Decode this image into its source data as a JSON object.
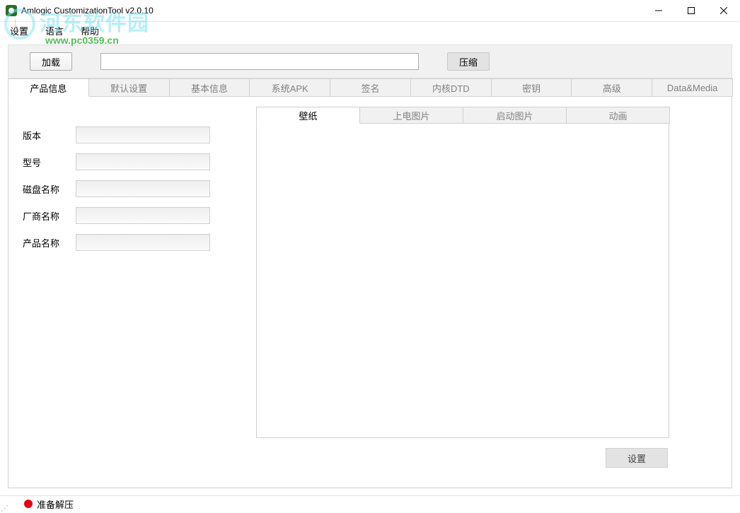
{
  "window": {
    "title": "Amlogic CustomizationTool v2.0.10"
  },
  "menu": {
    "settings": "设置",
    "language": "语言",
    "help": "帮助"
  },
  "watermark": {
    "text": "河东软件园",
    "url": "www.pc0359.cn"
  },
  "toolbar": {
    "load": "加载",
    "path_value": "",
    "compress": "压缩"
  },
  "mainTabs": [
    {
      "label": "产品信息",
      "active": true
    },
    {
      "label": "默认设置",
      "active": false
    },
    {
      "label": "基本信息",
      "active": false
    },
    {
      "label": "系统APK",
      "active": false
    },
    {
      "label": "签名",
      "active": false
    },
    {
      "label": "内核DTD",
      "active": false
    },
    {
      "label": "密钥",
      "active": false
    },
    {
      "label": "高级",
      "active": false
    },
    {
      "label": "Data&Media",
      "active": false
    }
  ],
  "form": {
    "version_label": "版本",
    "version_value": "",
    "model_label": "型号",
    "model_value": "",
    "disk_label": "磁盘名称",
    "disk_value": "",
    "vendor_label": "厂商名称",
    "vendor_value": "",
    "product_label": "产品名称",
    "product_value": ""
  },
  "subTabs": [
    {
      "label": "壁纸",
      "active": true
    },
    {
      "label": "上电图片",
      "active": false
    },
    {
      "label": "启动图片",
      "active": false
    },
    {
      "label": "动画",
      "active": false
    }
  ],
  "buttons": {
    "settings": "设置"
  },
  "status": {
    "text": "准备解压"
  }
}
